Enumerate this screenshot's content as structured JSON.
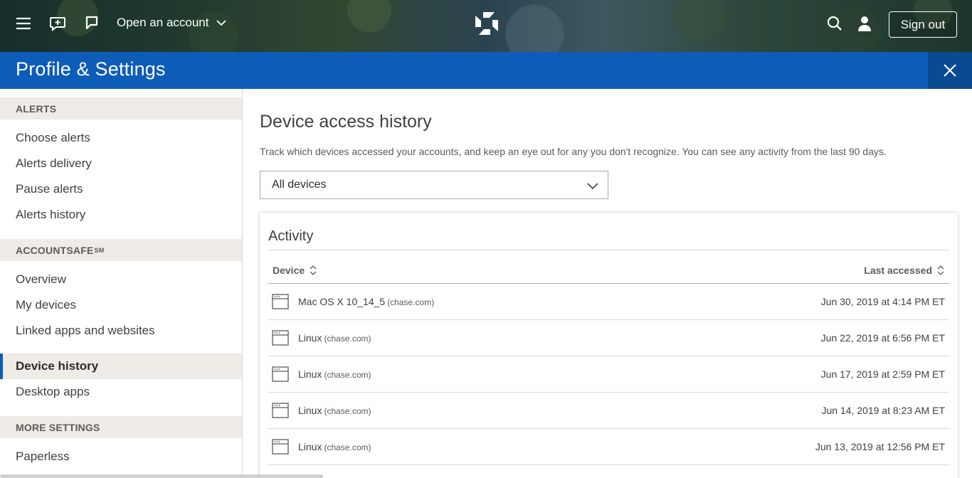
{
  "topbar": {
    "open_account_label": "Open an account",
    "sign_out_label": "Sign out",
    "icons": [
      "menu-icon",
      "chat-icon",
      "bookmark-icon",
      "chase-logo",
      "search-icon",
      "profile-icon"
    ]
  },
  "header": {
    "title": "Profile & Settings",
    "close_icon": "close-icon"
  },
  "sidebar": {
    "sections": [
      {
        "title": "ALERTS",
        "items": [
          "Choose alerts",
          "Alerts delivery",
          "Pause alerts",
          "Alerts history"
        ]
      },
      {
        "title": "ACCOUNTSAFE",
        "title_sup": "SM",
        "items": [
          "Overview",
          "My devices",
          "Linked apps and websites",
          "Device history",
          "Desktop apps"
        ]
      },
      {
        "title": "MORE SETTINGS",
        "items": [
          "Paperless"
        ]
      }
    ],
    "active_item": "Device history"
  },
  "main": {
    "title": "Device access history",
    "description": "Track which devices accessed your accounts, and keep an eye out for any you don't recognize. You can see any activity from the last 90 days.",
    "filter": {
      "selected": "All devices"
    },
    "activity": {
      "title": "Activity",
      "columns": {
        "device": "Device",
        "last_accessed": "Last accessed"
      },
      "rows": [
        {
          "device": "Mac OS X 10_14_5",
          "source": "(chase.com)",
          "time": "Jun 30, 2019 at 4:14 PM ET"
        },
        {
          "device": "Linux",
          "source": "(chase.com)",
          "time": "Jun 22, 2019 at 6:56 PM ET"
        },
        {
          "device": "Linux",
          "source": "(chase.com)",
          "time": "Jun 17, 2019 at 2:59 PM ET"
        },
        {
          "device": "Linux",
          "source": "(chase.com)",
          "time": "Jun 14, 2019 at 8:23 AM ET"
        },
        {
          "device": "Linux",
          "source": "(chase.com)",
          "time": "Jun 13, 2019 at 12:56 PM ET"
        }
      ]
    }
  },
  "colors": {
    "brand_blue": "#0d5cb8",
    "section_bg": "#efebe6"
  }
}
